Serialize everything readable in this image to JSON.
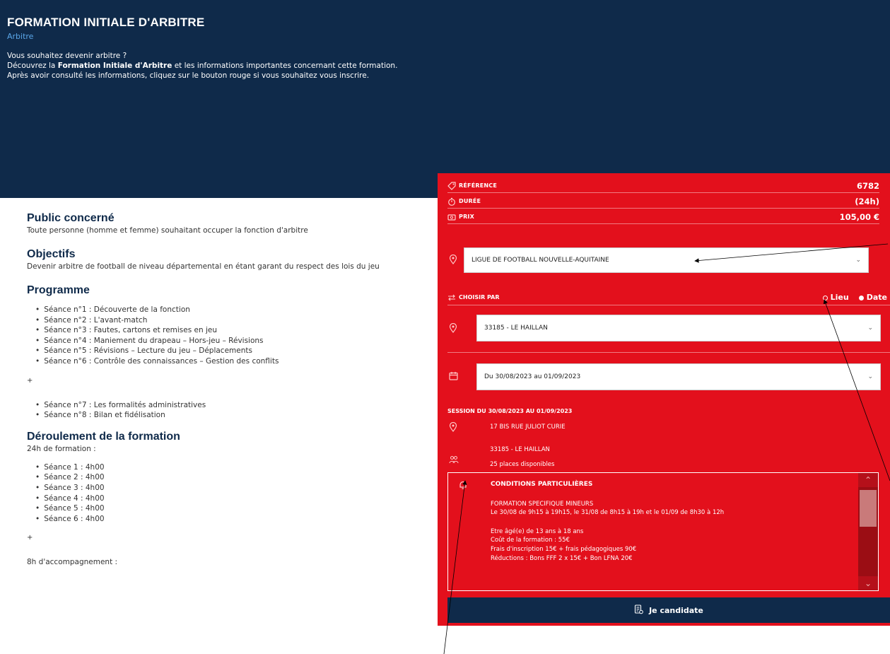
{
  "hero": {
    "title": "FORMATION INITIALE D'ARBITRE",
    "subtitle": "Arbitre",
    "line1": "Vous souhaitez devenir arbitre ?",
    "line2_pre": "Découvrez la ",
    "line2_bold": "Formation Initiale d'Arbitre",
    "line2_post": " et les informations importantes concernant cette formation.",
    "line3": "Après avoir consulté les informations, cliquez sur le bouton rouge si vous souhaitez vous inscrire."
  },
  "content": {
    "public_title": "Public concerné",
    "public_text": "Toute personne (homme et femme) souhaitant occuper la fonction d'arbitre",
    "objectifs_title": "Objectifs",
    "objectifs_text": "Devenir arbitre de football de niveau départemental en étant garant du respect des lois du jeu",
    "programme_title": "Programme",
    "programme_items": [
      "Séance n°1 : Découverte de la fonction",
      "Séance n°2 : L'avant-match",
      "Séance n°3 : Fautes, cartons et remises en jeu",
      "Séance n°4 : Maniement du drapeau – Hors-jeu – Révisions",
      "Séance n°5 : Révisions – Lecture du jeu – Déplacements",
      "Séance n°6 : Contrôle des connaissances – Gestion des conflits"
    ],
    "plus1": "+",
    "programme_items2": [
      "Séance n°7 : Les formalités administratives",
      "Séance n°8 : Bilan et fidélisation"
    ],
    "deroulement_title": "Déroulement de la formation",
    "deroulement_text": "24h de formation :",
    "seances": [
      "Séance 1 : 4h00",
      "Séance 2 : 4h00",
      "Séance 3 : 4h00",
      "Séance 4 : 4h00",
      "Séance 5 : 4h00",
      "Séance 6 : 4h00"
    ],
    "plus2": "+",
    "accompagnement": "8h d'accompagnement :"
  },
  "panel": {
    "reference_label": "RÉFÉRENCE",
    "reference_value": "6782",
    "duree_label": "DURÉE",
    "duree_value": "(24h)",
    "prix_label": "PRIX",
    "prix_value": "105,00 €",
    "ligue_select": "LIGUE DE FOOTBALL NOUVELLE-AQUITAINE",
    "choisir_label": "CHOISIR PAR",
    "opt_lieu": "Lieu",
    "opt_date": "Date",
    "lieu_select": "33185 - LE HAILLAN",
    "date_select": "Du 30/08/2023 au 01/09/2023",
    "session_title": "SESSION DU 30/08/2023 AU 01/09/2023",
    "address_line1": "17 BIS RUE JULIOT CURIE",
    "address_line2": "33185 - LE HAILLAN",
    "places": "25 places disponibles",
    "cond_title": "CONDITIONS PARTICULIÈRES",
    "cond_line1": "FORMATION SPECIFIQUE MINEURS",
    "cond_line2": "Le 30/08 de 9h15 à 19h15, le 31/08 de 8h15 à 19h et le 01/09 de 8h30 à 12h",
    "cond_line3": "Etre âgé(e) de 13 ans à 18 ans",
    "cond_line4": "Coût de la formation : 55€",
    "cond_line5": "Frais d'inscription 15€ + frais pédagogiques 90€",
    "cond_line6": "Réductions : Bons FFF 2 x 15€ + Bon LFNA 20€",
    "cta": "Je candidate"
  },
  "colors": {
    "navy": "#0f2a4a",
    "red": "#e3101c",
    "accent_blue": "#5aa6e8"
  },
  "icons": [
    "tag-icon",
    "stopwatch-icon",
    "price-icon",
    "location-pin-icon",
    "swap-arrows-icon",
    "calendar-icon",
    "people-icon",
    "bell-icon",
    "chevron-down-icon",
    "document-icon"
  ]
}
